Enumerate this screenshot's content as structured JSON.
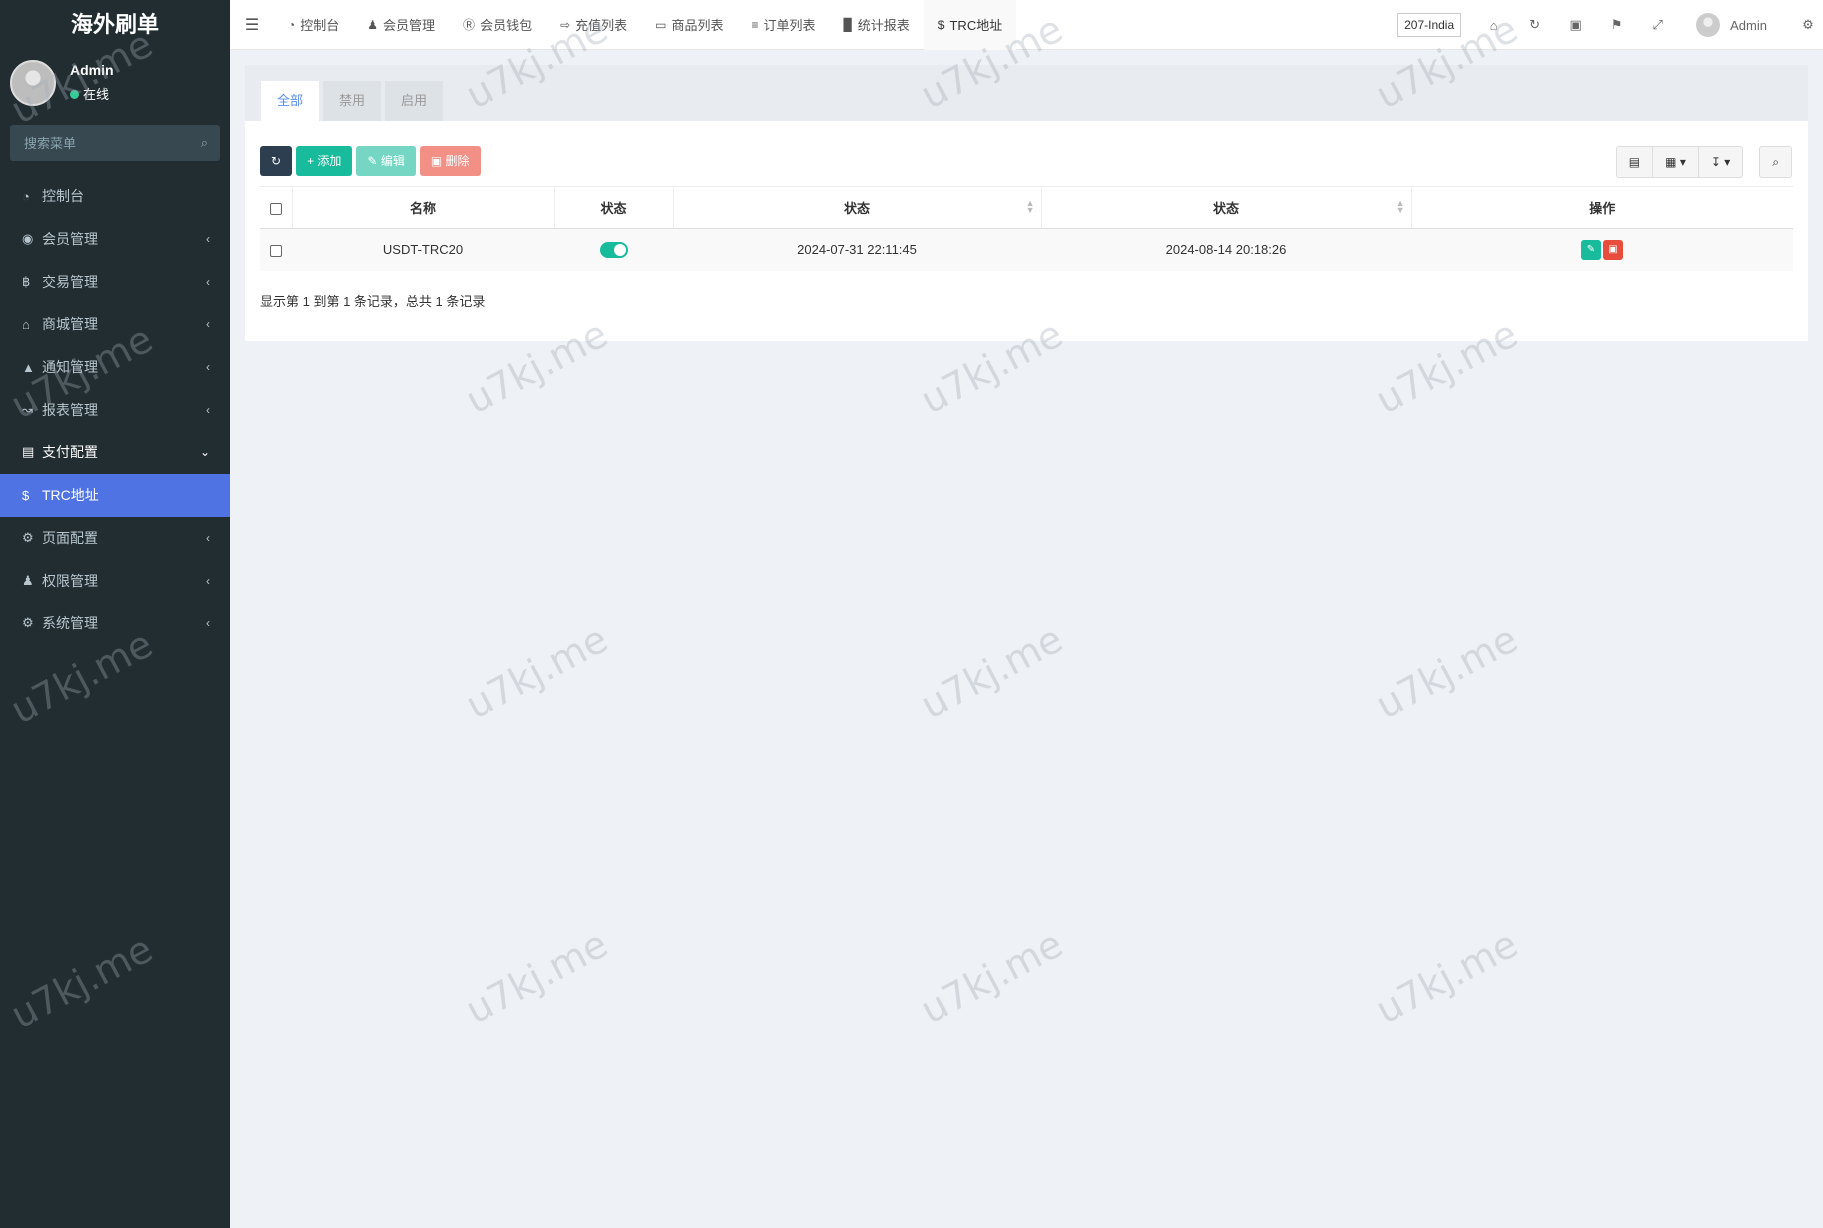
{
  "sidebar": {
    "logo": "海外刷单",
    "user_name": "Admin",
    "user_status": "在线",
    "search_placeholder": "搜索菜单",
    "items": [
      {
        "label": "控制台",
        "icon": "dashboard-icon",
        "caret": ""
      },
      {
        "label": "会员管理",
        "icon": "user-circle-icon",
        "caret": "‹"
      },
      {
        "label": "交易管理",
        "icon": "bitcoin-icon",
        "caret": "‹"
      },
      {
        "label": "商城管理",
        "icon": "home-icon",
        "caret": "‹"
      },
      {
        "label": "通知管理",
        "icon": "bell-icon",
        "caret": "‹"
      },
      {
        "label": "报表管理",
        "icon": "line-chart-icon",
        "caret": "‹"
      },
      {
        "label": "支付配置",
        "icon": "credit-card-icon",
        "caret": "⌄"
      },
      {
        "label": "TRC地址",
        "icon": "dollar-icon",
        "caret": ""
      },
      {
        "label": "页面配置",
        "icon": "gear-icon",
        "caret": "‹"
      },
      {
        "label": "权限管理",
        "icon": "group-icon",
        "caret": "‹"
      },
      {
        "label": "系统管理",
        "icon": "gears-icon",
        "caret": "‹"
      }
    ]
  },
  "topnav": {
    "tabs": [
      {
        "label": "控制台",
        "icon": "dashboard-icon"
      },
      {
        "label": "会员管理",
        "icon": "user-icon"
      },
      {
        "label": "会员钱包",
        "icon": "wallet-icon"
      },
      {
        "label": "充值列表",
        "icon": "sign-in-icon"
      },
      {
        "label": "商品列表",
        "icon": "desktop-icon"
      },
      {
        "label": "订单列表",
        "icon": "list-icon"
      },
      {
        "label": "统计报表",
        "icon": "bar-chart-icon"
      },
      {
        "label": "TRC地址",
        "icon": "dollar-icon"
      }
    ],
    "lang": "207-India",
    "admin_name": "Admin"
  },
  "content": {
    "filter_tabs": [
      "全部",
      "禁用",
      "启用"
    ],
    "toolbar": {
      "add": "添加",
      "edit": "编辑",
      "delete": "删除"
    },
    "columns": [
      "名称",
      "状态",
      "状态",
      "状态",
      "操作"
    ],
    "rows": [
      {
        "name": "USDT-TRC20",
        "enabled": true,
        "created": "2024-07-31 22:11:45",
        "updated": "2024-08-14 20:18:26"
      }
    ],
    "pager": "显示第 1 到第 1 条记录，总共 1 条记录"
  },
  "watermark": "u7kj.me",
  "colors": {
    "sidebar_bg": "#222d32",
    "active": "#4f73e3",
    "success": "#18bc9c",
    "danger": "#e74c3c"
  }
}
